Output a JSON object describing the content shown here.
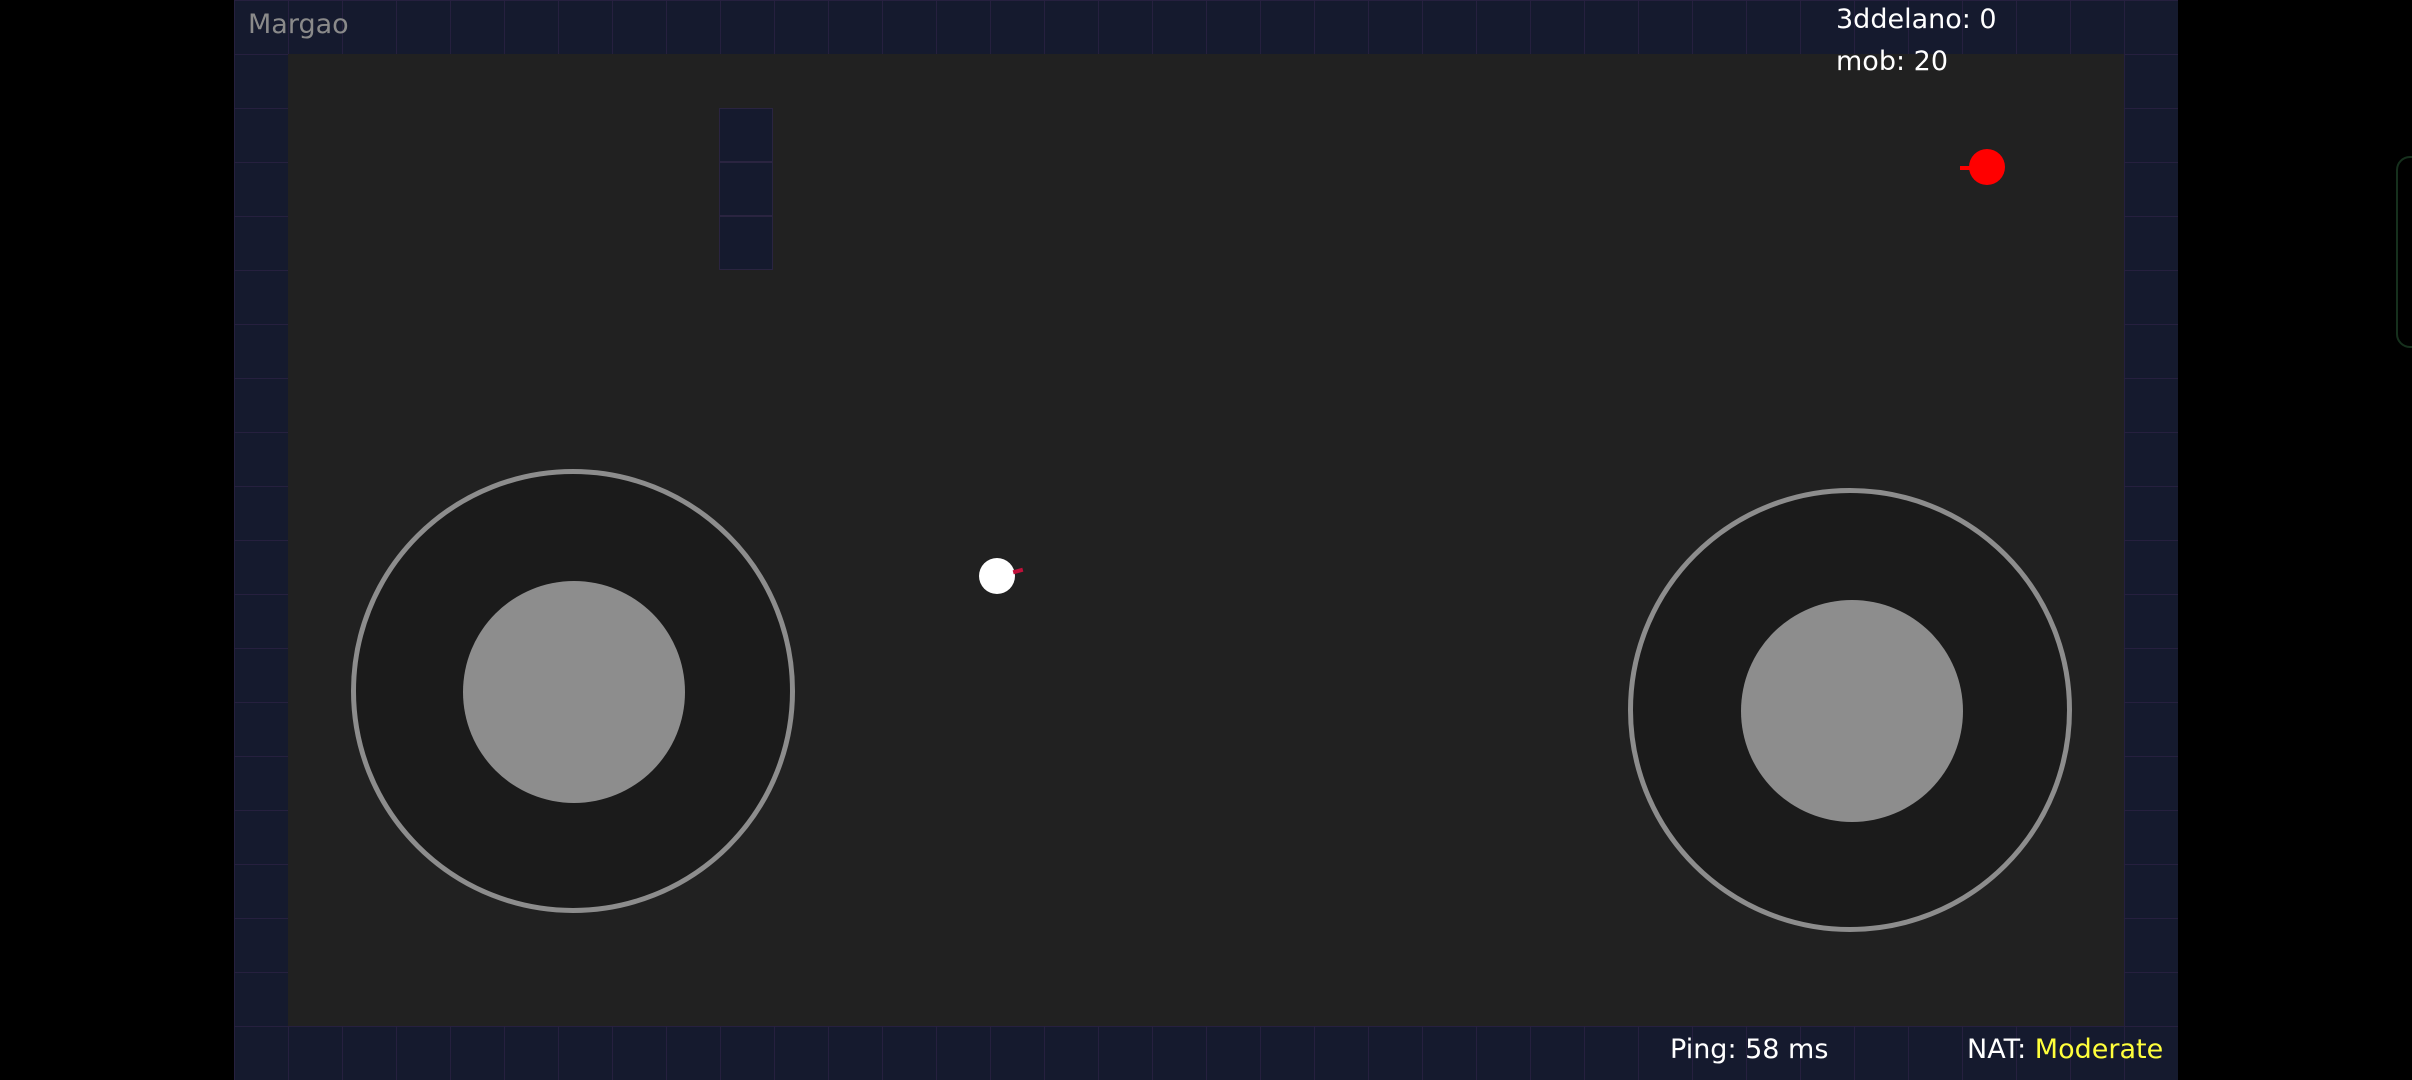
{
  "hud": {
    "server_name": "Margao",
    "scores": {
      "player_label": "3ddelano: 0",
      "mob_label": "mob: 20"
    },
    "ping_label": "Ping: 58 ms",
    "nat_prefix": "NAT: ",
    "nat_value": "Moderate"
  },
  "colors": {
    "wall": "#151a2e",
    "floor": "#212121",
    "player": "#ffffff",
    "mob": "#ff0000",
    "nat_status": "#ffff3b",
    "joystick": "#8d8d8d"
  },
  "controls": {
    "left_joystick": "movement-joystick",
    "right_joystick": "aim-joystick"
  }
}
